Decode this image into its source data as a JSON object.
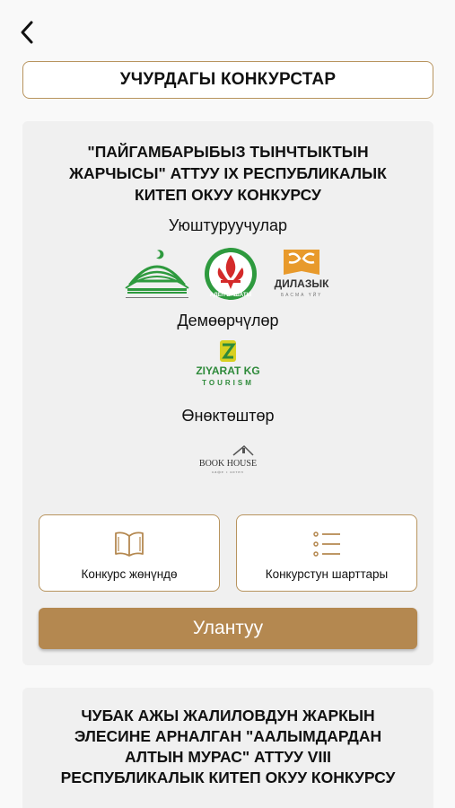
{
  "header": {
    "back_icon": "chevron-left-icon"
  },
  "section": {
    "title": "УЧУРДАГЫ КОНКУРСТАР"
  },
  "contest": {
    "title_lines": [
      "\"ПАЙГАМБАРЫБЫЗ ТЫНЧТЫКТЫН",
      "ЖАРЧЫСЫ\" АТТУУ IX РЕСПУБЛИКАЛЫК",
      "КИТЕП ОКУУ КОНКУРСУ"
    ],
    "organizers_label": "Уюштуруучулар",
    "sponsors_label": "Демөөрчүлөр",
    "partners_label": "Өнөктөштөр",
    "logos": {
      "adep_text": "АДЕП БАШАТЫ",
      "dilazyk_text": "ДИЛАЗЫК",
      "dilazyk_sub": "БАСМА ҮЙҮ",
      "ziyarat_text": "ZIYARAT KG",
      "ziyarat_sub": "TOURISM",
      "bookhouse_text": "BOOK HOUSE",
      "bookhouse_sub": "кафе • китеп"
    },
    "about_button": "Конкурс жөнүндө",
    "rules_button": "Конкурстун шарттары",
    "cta": "Улантуу"
  },
  "contest2": {
    "title_lines": [
      "ЧУБАК АЖЫ ЖАЛИЛОВДУН ЖАРКЫН",
      "ЭЛЕСИНЕ АРНАЛГАН \"ААЛЫМДАРДАН",
      "АЛТЫН МУРАС\"  АТТУУ VIII",
      "РЕСПУБЛИКАЛЫК КИТЕП ОКУУ КОНКУРСУ"
    ]
  },
  "colors": {
    "accent": "#b48850",
    "border": "#b8945e",
    "card": "#f0f0f0",
    "green": "#2e9a3e",
    "red": "#d42a2a",
    "orange": "#e89a2c"
  }
}
